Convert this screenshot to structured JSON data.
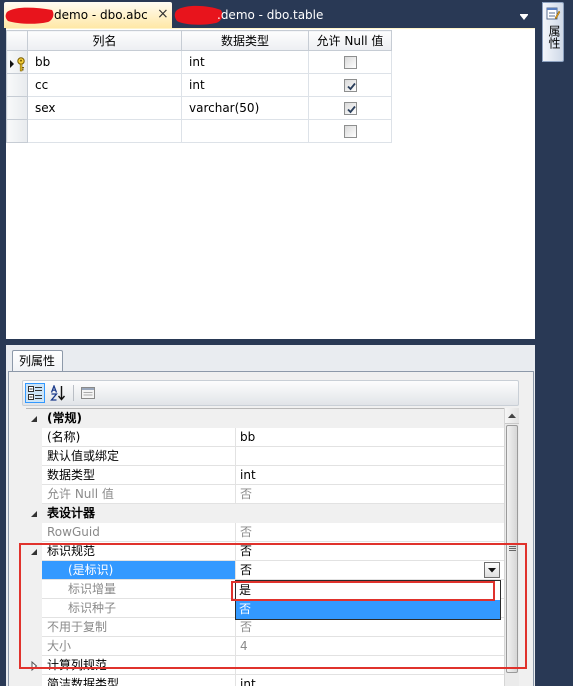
{
  "tabs": [
    {
      "label": "demo - dbo.abc",
      "close": "×",
      "active": true
    },
    {
      "label": ".demo - dbo.table",
      "active": false
    }
  ],
  "tab_overflow_icon": "chevron-down-icon",
  "side_panel": {
    "label": "属性",
    "icon": "properties-icon"
  },
  "grid": {
    "headers": [
      "列名",
      "数据类型",
      "允许 Null 值"
    ],
    "rows": [
      {
        "name": "bb",
        "type": "int",
        "allow_null": false,
        "primary_key": true,
        "current": true
      },
      {
        "name": "cc",
        "type": "int",
        "allow_null": true
      },
      {
        "name": "sex",
        "type": "varchar(50)",
        "allow_null": true
      },
      {
        "name": "",
        "type": "",
        "allow_null": false
      }
    ]
  },
  "column_properties": {
    "tab_label": "列属性",
    "toolbar": {
      "categorized_icon": "categorized-icon",
      "alphabetical_icon": "alphabetical-sort-icon",
      "property_pages_icon": "property-pages-icon",
      "categorized_active": true
    },
    "rows": [
      {
        "label": "(常规)",
        "category": true,
        "expanded": true
      },
      {
        "label": "(名称)",
        "value": "bb"
      },
      {
        "label": "默认值或绑定",
        "value": ""
      },
      {
        "label": "数据类型",
        "value": "int"
      },
      {
        "label": "允许 Null 值",
        "value": "否",
        "disabled": true
      },
      {
        "label": "表设计器",
        "category": true,
        "expanded": true
      },
      {
        "label": "RowGuid",
        "value": "否",
        "disabled": true
      },
      {
        "label": "标识规范",
        "value": "否",
        "expandable": true,
        "expanded": true
      },
      {
        "label": "(是标识)",
        "value": "否",
        "child": true,
        "selected": true
      },
      {
        "label": "标识增量",
        "value": "",
        "child": true,
        "disabled": true
      },
      {
        "label": "标识种子",
        "value": "",
        "child": true,
        "disabled": true
      },
      {
        "label": "不用于复制",
        "value": "否",
        "disabled": true
      },
      {
        "label": "大小",
        "value": "4",
        "disabled": true
      },
      {
        "label": "计算列规范",
        "value": "",
        "expandable": true,
        "expanded": false
      },
      {
        "label": "简洁数据类型",
        "value": "int"
      }
    ],
    "dropdown": {
      "options": [
        {
          "label": "是",
          "highlighted": false
        },
        {
          "label": "否",
          "highlighted": true
        }
      ]
    }
  },
  "colors": {
    "frame": "#293955",
    "active_tab": "#ffe8a6",
    "selection": "#3399ff",
    "annotation": "#e0322c"
  }
}
